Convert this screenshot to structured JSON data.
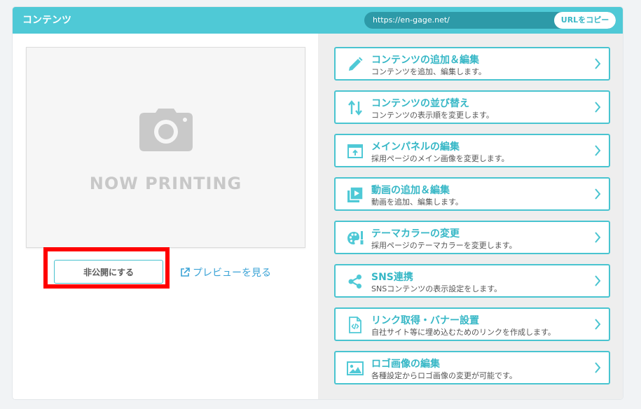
{
  "header": {
    "title": "コンテンツ",
    "url": "https://en-gage.net/",
    "copy_label": "URLをコピー"
  },
  "preview": {
    "placeholder_text": "NOW PRINTING",
    "private_button": "非公開にする",
    "preview_link": "プレビューを見る"
  },
  "menu": [
    {
      "title": "コンテンツの追加＆編集",
      "desc": "コンテンツを追加、編集します。",
      "icon": "pencil-icon"
    },
    {
      "title": "コンテンツの並び替え",
      "desc": "コンテンツの表示順を変更します。",
      "icon": "sort-arrows-icon"
    },
    {
      "title": "メインパネルの編集",
      "desc": "採用ページのメイン画像を変更します。",
      "icon": "main-panel-icon"
    },
    {
      "title": "動画の追加＆編集",
      "desc": "動画を追加、編集します。",
      "icon": "video-play-icon"
    },
    {
      "title": "テーマカラーの変更",
      "desc": "採用ページのテーマカラーを変更します。",
      "icon": "palette-icon"
    },
    {
      "title": "SNS連携",
      "desc": "SNSコンテンツの表示設定をします。",
      "icon": "share-icon"
    },
    {
      "title": "リンク取得・バナー設置",
      "desc": "自社サイト等に埋め込むためのリンクを作成します。",
      "icon": "code-file-icon"
    },
    {
      "title": "ロゴ画像の編集",
      "desc": "各種設定からロゴ画像の変更が可能です。",
      "icon": "image-icon"
    }
  ],
  "colors": {
    "accent": "#4fc9d6",
    "title_text": "#36b7c6",
    "link": "#3ba3d6",
    "highlight": "#ff0000"
  }
}
